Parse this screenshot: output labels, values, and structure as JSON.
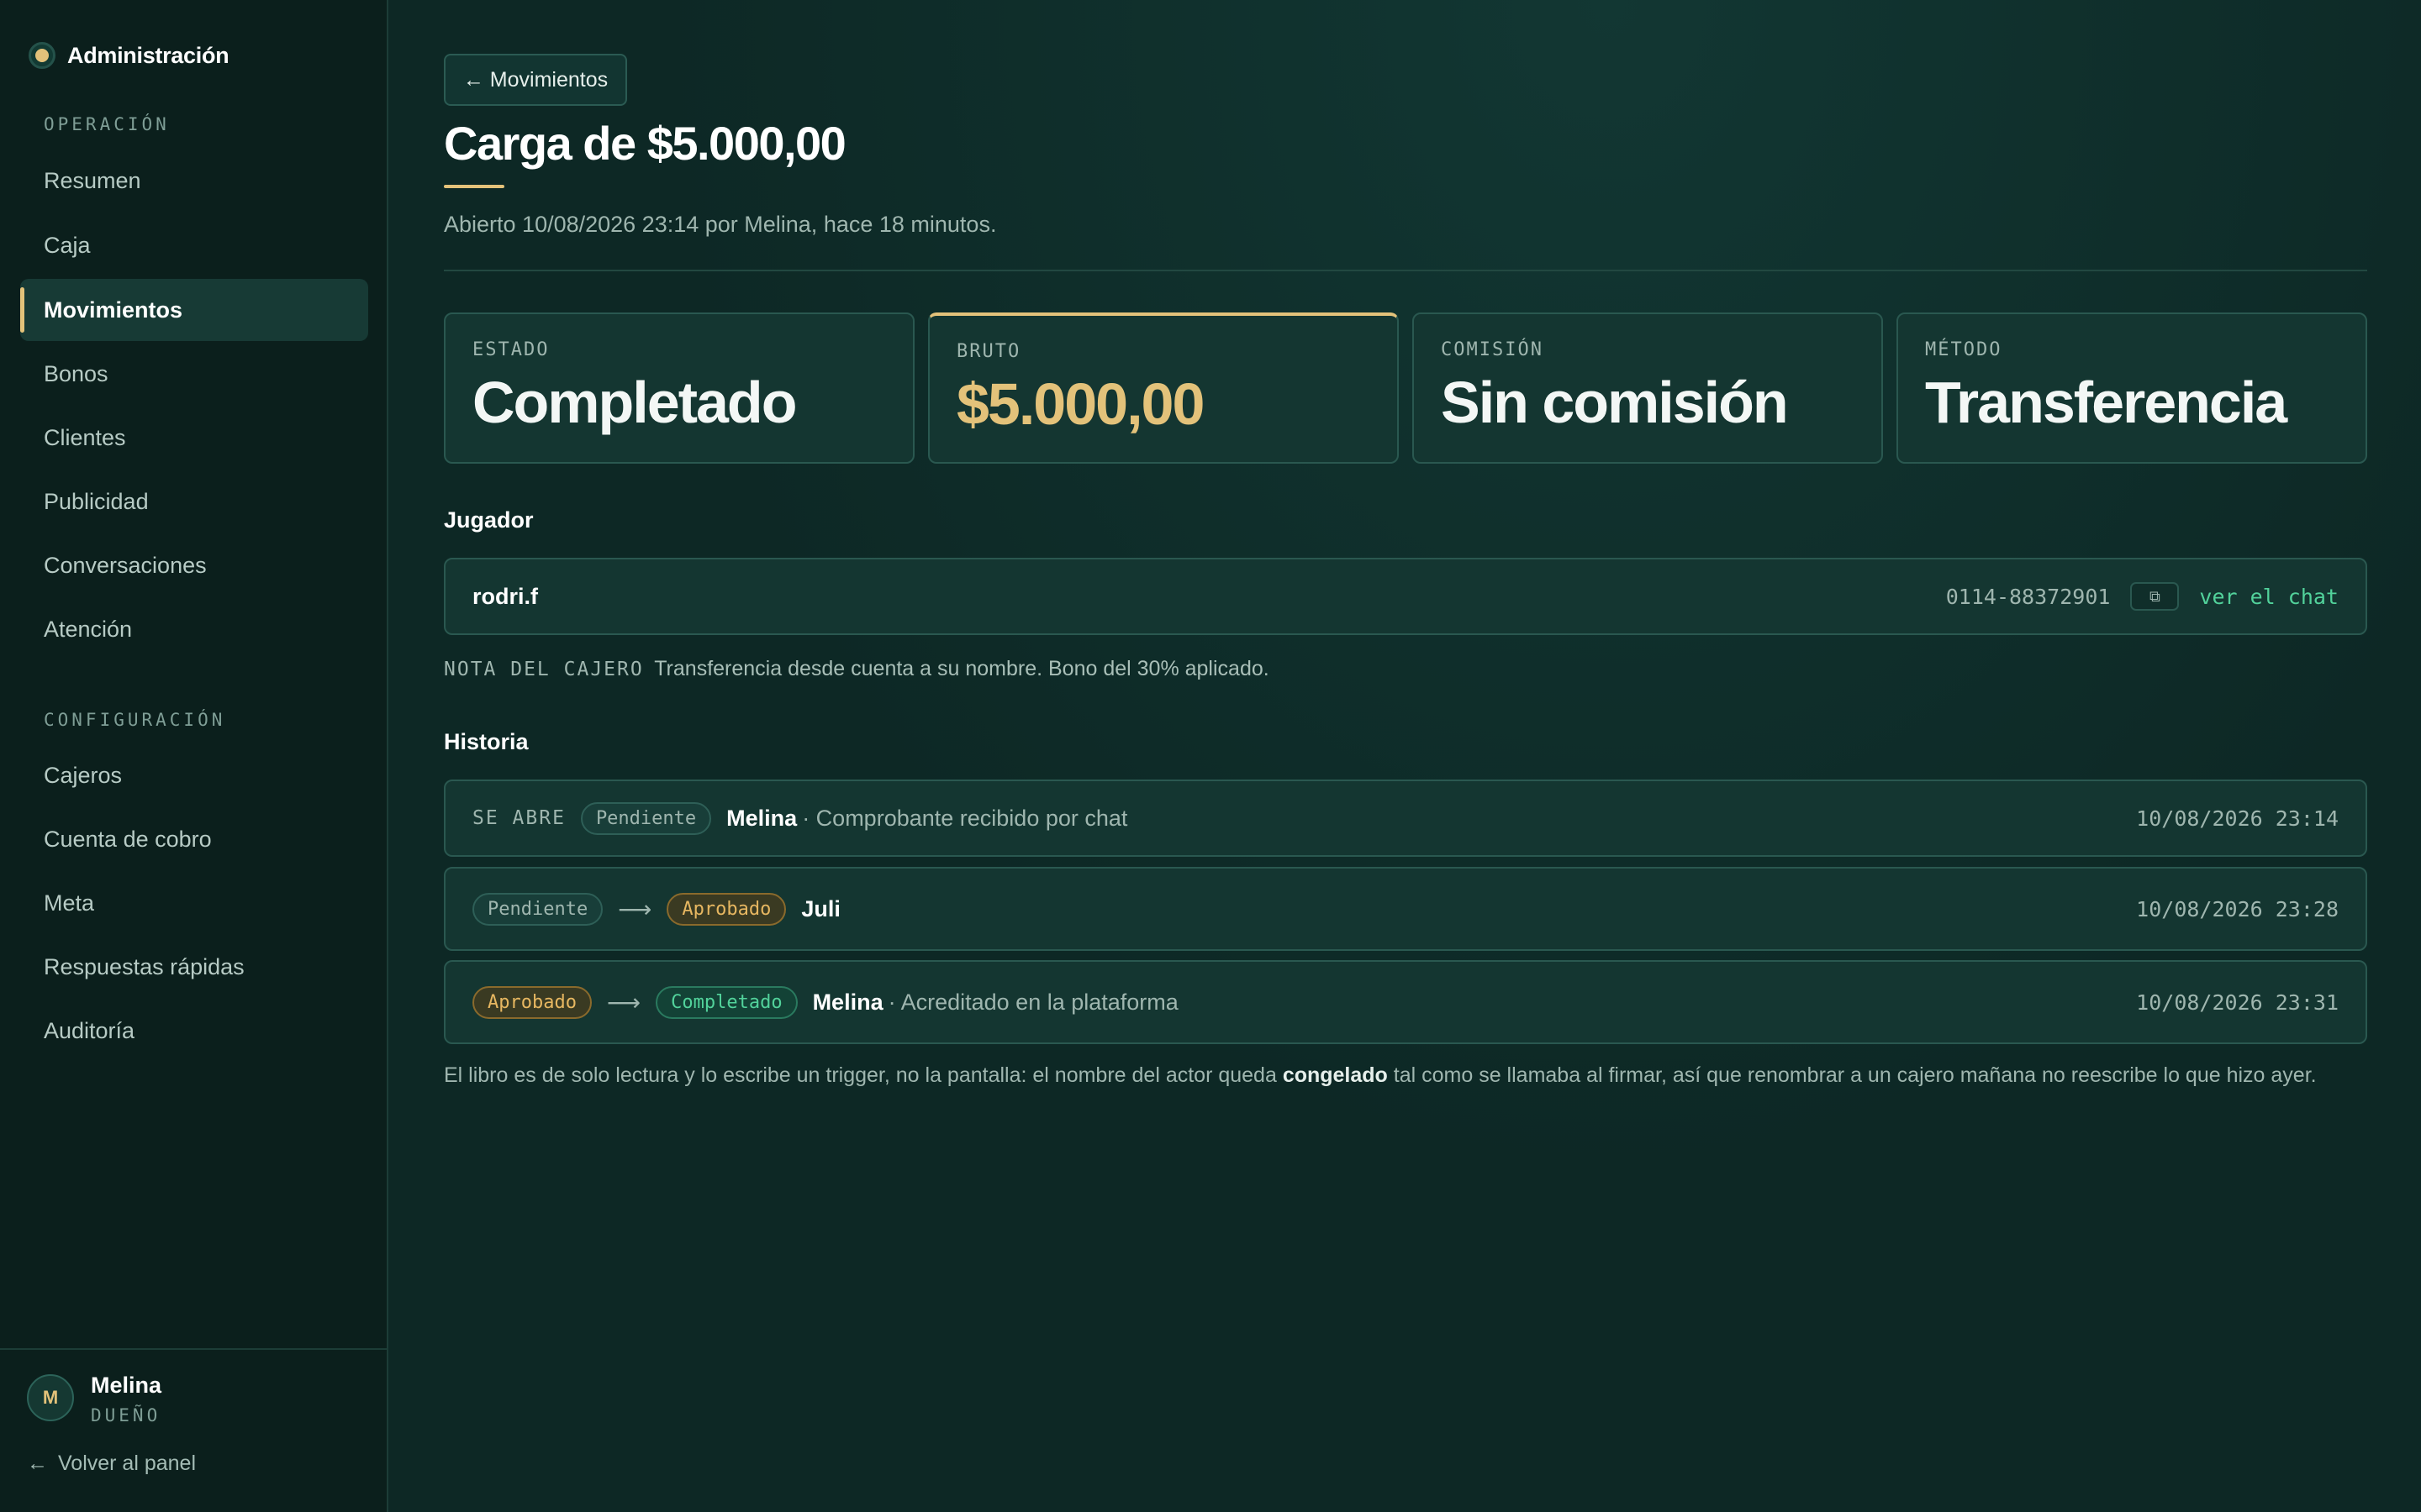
{
  "sidebar": {
    "brand": "Administración",
    "sections": [
      {
        "label": "OPERACIÓN",
        "items": [
          "Resumen",
          "Caja",
          "Movimientos",
          "Bonos",
          "Clientes",
          "Publicidad",
          "Conversaciones",
          "Atención"
        ]
      },
      {
        "label": "CONFIGURACIÓN",
        "items": [
          "Cajeros",
          "Cuenta de cobro",
          "Meta",
          "Respuestas rápidas",
          "Auditoría"
        ]
      }
    ],
    "active_item": "Movimientos",
    "user": {
      "initial": "M",
      "name": "Melina",
      "role": "DUEÑO"
    },
    "back_link": "Volver al panel",
    "back_arrow": "←"
  },
  "header": {
    "back_button": "← Movimientos",
    "title": "Carga de $5.000,00",
    "subtitle": "Abierto 10/08/2026 23:14 por Melina, hace 18 minutos."
  },
  "stats": [
    {
      "label": "ESTADO",
      "value": "Completado"
    },
    {
      "label": "BRUTO",
      "value": "$5.000,00"
    },
    {
      "label": "COMISIÓN",
      "value": "Sin comisión"
    },
    {
      "label": "MÉTODO",
      "value": "Transferencia"
    }
  ],
  "player": {
    "section_title": "Jugador",
    "username": "rodri.f",
    "phone": "0114-88372901",
    "copy_icon": "copy-icon",
    "chat_link": "ver el chat"
  },
  "note": {
    "label": "NOTA DEL CAJERO",
    "text": "Transferencia desde cuenta a su nombre. Bono del 30% aplicado."
  },
  "history": {
    "section_title": "Historia",
    "arrow": "⟶",
    "rows": [
      {
        "opener": "SE ABRE",
        "to": "Pendiente",
        "actor": "Melina",
        "comment": "· Comprobante recibido por chat",
        "time": "10/08/2026 23:14"
      },
      {
        "from": "Pendiente",
        "to": "Aprobado",
        "actor": "Juli",
        "comment": "",
        "time": "10/08/2026 23:28"
      },
      {
        "from": "Aprobado",
        "to": "Completado",
        "actor": "Melina",
        "comment": "· Acreditado en la plataforma",
        "time": "10/08/2026 23:31"
      }
    ]
  },
  "footnote": {
    "before": "El libro es de solo lectura y lo escribe un trigger, no la pantalla: el nombre del actor queda",
    "bold": "congelado",
    "after": "tal como se llamaba al firmar, así que renombrar a un cajero mañana no reescribe lo que hizo ayer."
  },
  "colors": {
    "accent": "#e3c27a",
    "success": "#52d29b",
    "background": "#0d2825"
  }
}
